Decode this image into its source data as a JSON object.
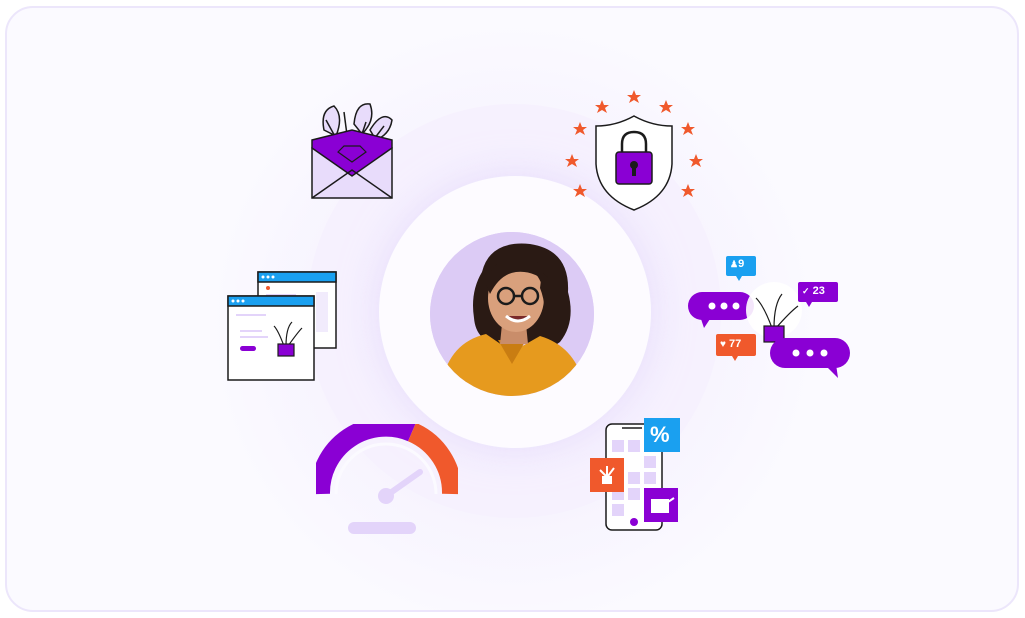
{
  "colors": {
    "purple": "#8a00d4",
    "light_purple": "#e3d4fa",
    "orange": "#f0592c",
    "blue": "#1aa0f0",
    "background": "#fbfaff"
  },
  "portrait": {
    "icon": "woman-with-glasses-portrait"
  },
  "security": {
    "icon": "shield-lock-icon",
    "star_count": 10
  },
  "email": {
    "icon": "open-envelope-icon"
  },
  "browser": {
    "icon": "browser-windows-icon"
  },
  "social": {
    "icon": "chat-bubbles-icon",
    "followers_count": "9",
    "likes_count": "77",
    "comments_count": "23"
  },
  "speed": {
    "icon": "speedometer-gauge-icon"
  },
  "mobile": {
    "icon": "mobile-phone-icon",
    "discount_symbol": "%"
  }
}
